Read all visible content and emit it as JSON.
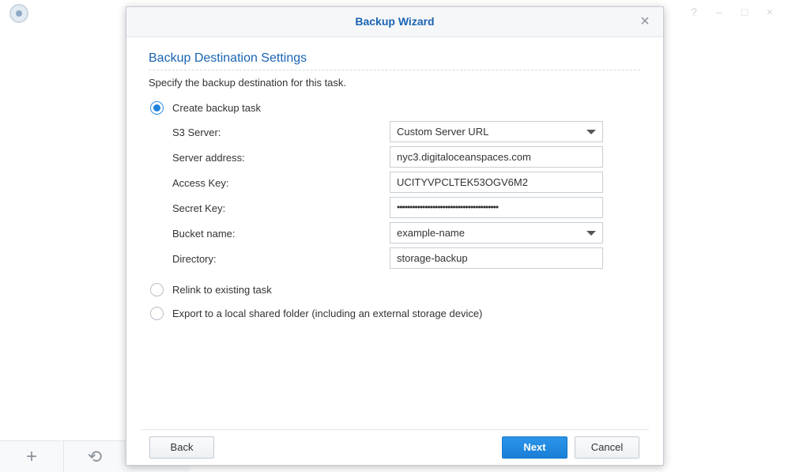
{
  "dialog": {
    "title": "Backup Wizard",
    "close_icon": "×"
  },
  "section": {
    "title": "Backup Destination Settings",
    "description": "Specify the backup destination for this task."
  },
  "options": {
    "create": {
      "label": "Create backup task",
      "checked": true
    },
    "relink": {
      "label": "Relink to existing task",
      "checked": false
    },
    "export": {
      "label": "Export to a local shared folder (including an external storage device)",
      "checked": false
    }
  },
  "fields": {
    "s3_server": {
      "label": "S3 Server:",
      "value": "Custom Server URL"
    },
    "server_address": {
      "label": "Server address:",
      "value": "nyc3.digitaloceanspaces.com"
    },
    "access_key": {
      "label": "Access Key:",
      "value": "UCITYVPCLTEK53OGV6M2"
    },
    "secret_key": {
      "label": "Secret Key:",
      "value": "••••••••••••••••••••••••••••••••••••••••"
    },
    "bucket_name": {
      "label": "Bucket name:",
      "value": "example-name"
    },
    "directory": {
      "label": "Directory:",
      "value": "storage-backup"
    }
  },
  "buttons": {
    "back": "Back",
    "next": "Next",
    "cancel": "Cancel"
  },
  "background": {
    "add_icon": "+",
    "history_icon": "⟲",
    "window_controls": [
      "?",
      "–",
      "□",
      "×"
    ]
  },
  "colors": {
    "accent": "#1a64b2",
    "primary_button": "#1f82dc"
  }
}
